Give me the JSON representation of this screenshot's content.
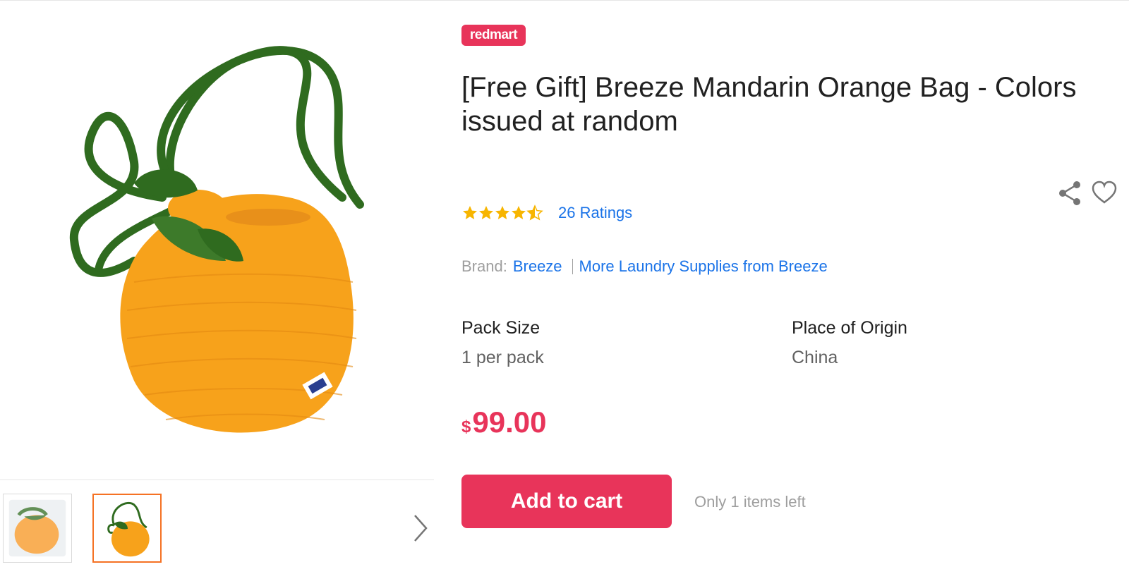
{
  "gallery": {
    "main_image": {
      "alt": "crochet-orange-bag-icon"
    },
    "thumbnails": [
      {
        "icon": "packaged-bag-thumbnail",
        "active": false
      },
      {
        "icon": "orange-bag-thumbnail",
        "active": true
      }
    ],
    "next_icon": "chevron-right-icon"
  },
  "product": {
    "badge": "redmart",
    "title": "[Free Gift] Breeze Mandarin Orange Bag - Colors issued at random",
    "rating": {
      "stars": 4.5,
      "max": 5,
      "ratings_text": "26 Ratings"
    },
    "brand": {
      "label": "Brand:",
      "name": "Breeze",
      "more_link": "More Laundry Supplies from Breeze"
    },
    "specs": [
      {
        "name": "Pack Size",
        "value": "1 per pack"
      },
      {
        "name": "Place of Origin",
        "value": "China"
      }
    ],
    "price": {
      "currency": "$",
      "amount": "99.00"
    },
    "add_to_cart_label": "Add to cart",
    "stock_note": "Only 1 items left"
  },
  "icons": {
    "share": "share-icon",
    "wishlist": "heart-icon",
    "star": "star-icon"
  },
  "colors": {
    "accent": "#e8345a",
    "link": "#1a73e8",
    "star": "#f7b500",
    "thumb_active_border": "#f57224",
    "bag_orange": "#f7a21b",
    "strap_green": "#2f6b1f"
  }
}
